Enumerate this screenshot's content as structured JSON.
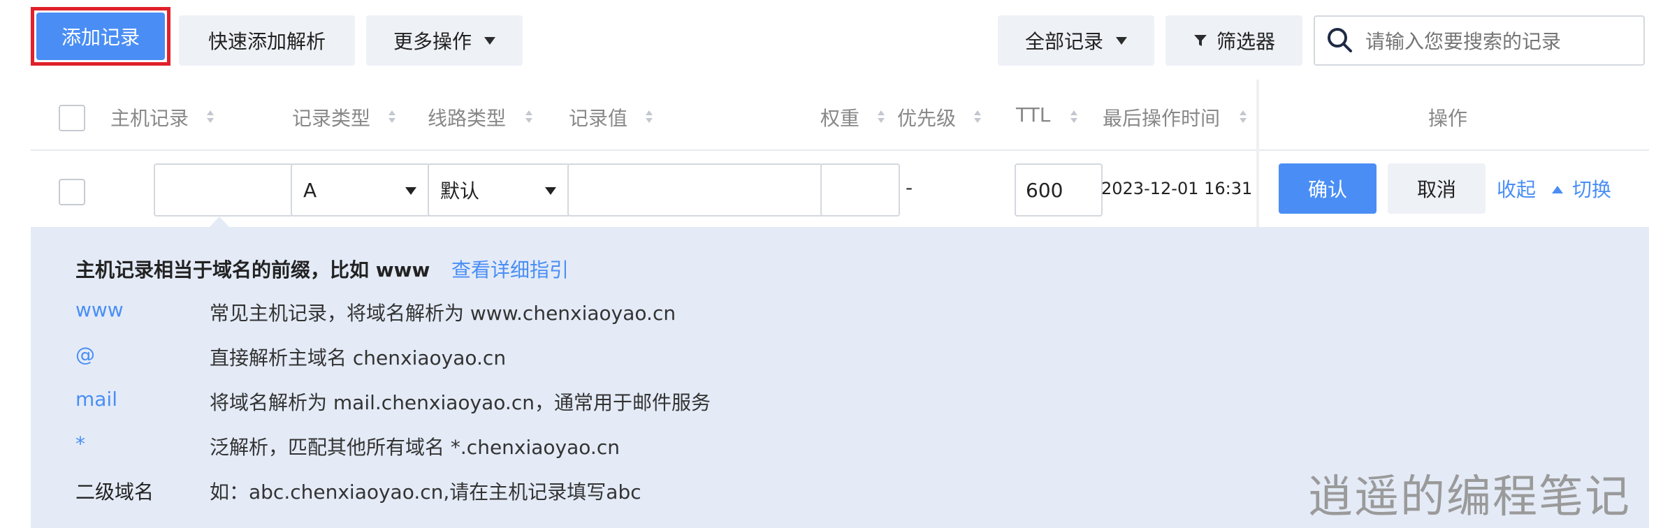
{
  "toolbar": {
    "add_record": "添加记录",
    "quick_add": "快速添加解析",
    "more_actions": "更多操作",
    "all_records": "全部记录",
    "filter": "筛选器",
    "search_placeholder": "请输入您要搜索的记录"
  },
  "table": {
    "headers": {
      "host": "主机记录",
      "type": "记录类型",
      "line": "线路类型",
      "value": "记录值",
      "weight": "权重",
      "priority": "优先级",
      "ttl": "TTL",
      "last_modified": "最后操作时间",
      "actions": "操作"
    },
    "edit_row": {
      "host_value": "",
      "type_value": "A",
      "line_value": "默认",
      "record_value": "",
      "weight_value": "",
      "priority_value": "-",
      "ttl_value": "600",
      "last_modified": "2023-12-01 16:31",
      "confirm": "确认",
      "cancel": "取消",
      "collapse": "收起",
      "switch": "切换"
    }
  },
  "hint_panel": {
    "title": "主机记录相当于域名的前缀，比如 www",
    "guide_link": "查看详细指引",
    "rows": [
      {
        "key": "www",
        "desc": "常见主机记录，将域名解析为 www.chenxiaoyao.cn"
      },
      {
        "key": "@",
        "desc": "直接解析主域名 chenxiaoyao.cn"
      },
      {
        "key": "mail",
        "desc": "将域名解析为 mail.chenxiaoyao.cn，通常用于邮件服务"
      },
      {
        "key": "*",
        "desc": "泛解析，匹配其他所有域名 *.chenxiaoyao.cn"
      },
      {
        "key": "二级域名",
        "desc": "如：abc.chenxiaoyao.cn,请在主机记录填写abc"
      }
    ]
  },
  "watermark": "逍遥的编程笔记",
  "highlight_color": "#e0202a",
  "accent_color": "#4a8ef5"
}
